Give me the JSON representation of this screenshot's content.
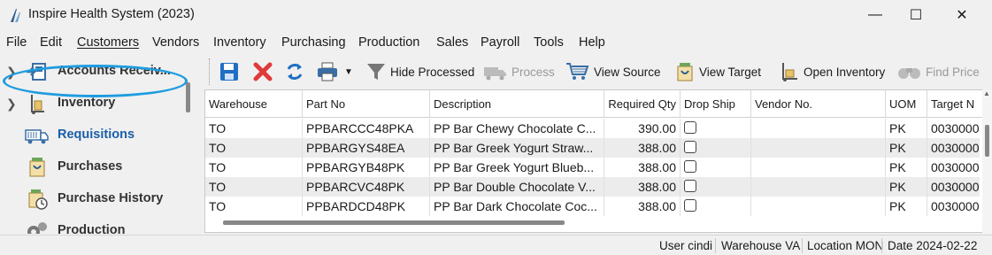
{
  "window": {
    "title": "Inspire Health System (2023)",
    "minimize": "—",
    "maximize": "☐",
    "close": "✕"
  },
  "menu": [
    "File",
    "Edit",
    "Customers",
    "Vendors",
    "Inventory",
    "Purchasing",
    "Production",
    "Sales",
    "Payroll",
    "Tools",
    "Help"
  ],
  "sidebar": {
    "items": [
      {
        "label": "Accounts Receiv...",
        "icon": "accounts-receivable-icon",
        "expandable": true
      },
      {
        "label": "Inventory",
        "icon": "inventory-icon",
        "expandable": true
      },
      {
        "label": "Requisitions",
        "icon": "truck-icon",
        "selected": true
      },
      {
        "label": "Purchases",
        "icon": "purchase-bag-icon"
      },
      {
        "label": "Purchase History",
        "icon": "purchase-history-icon"
      },
      {
        "label": "Production",
        "icon": "gears-icon"
      }
    ]
  },
  "toolbar": {
    "save": "save-icon",
    "delete": "delete-icon",
    "refresh": "refresh-icon",
    "print": "print-icon",
    "hide_processed": "Hide Processed",
    "process": "Process",
    "view_source": "View Source",
    "view_target": "View Target",
    "open_inventory": "Open Inventory",
    "find_price": "Find Price"
  },
  "table": {
    "columns": [
      "Warehouse",
      "Part No",
      "Description",
      "Required Qty",
      "Drop Ship",
      "Vendor No.",
      "UOM",
      "Target N"
    ],
    "rows": [
      {
        "warehouse": "TO",
        "part_no": "PPBARCCC48PKA",
        "description": "PP Bar Chewy Chocolate C...",
        "qty": "390.00",
        "drop_ship": false,
        "vendor": "",
        "uom": "PK",
        "target": "0030000"
      },
      {
        "warehouse": "TO",
        "part_no": "PPBARGYS48EA",
        "description": "PP Bar Greek Yogurt Straw...",
        "qty": "388.00",
        "drop_ship": false,
        "vendor": "",
        "uom": "PK",
        "target": "0030000"
      },
      {
        "warehouse": "TO",
        "part_no": "PPBARGYB48PK",
        "description": "PP Bar Greek Yogurt Blueb...",
        "qty": "388.00",
        "drop_ship": false,
        "vendor": "",
        "uom": "PK",
        "target": "0030000"
      },
      {
        "warehouse": "TO",
        "part_no": "PPBARCVC48PK",
        "description": "PP Bar Double Chocolate V...",
        "qty": "388.00",
        "drop_ship": false,
        "vendor": "",
        "uom": "PK",
        "target": "0030000"
      },
      {
        "warehouse": "TO",
        "part_no": "PPBARDCD48PK",
        "description": "PP Bar Dark Chocolate Coc...",
        "qty": "388.00",
        "drop_ship": false,
        "vendor": "",
        "uom": "PK",
        "target": "0030000"
      }
    ]
  },
  "status": {
    "user": "User cindi",
    "warehouse": "Warehouse VA",
    "location": "Location MON",
    "date": "Date 2024-02-22"
  },
  "colors": {
    "accent": "#1a5fa8",
    "highlight": "#1e9ce0",
    "delete": "#e03a3a",
    "toolbar_blue": "#1f6fc4"
  }
}
